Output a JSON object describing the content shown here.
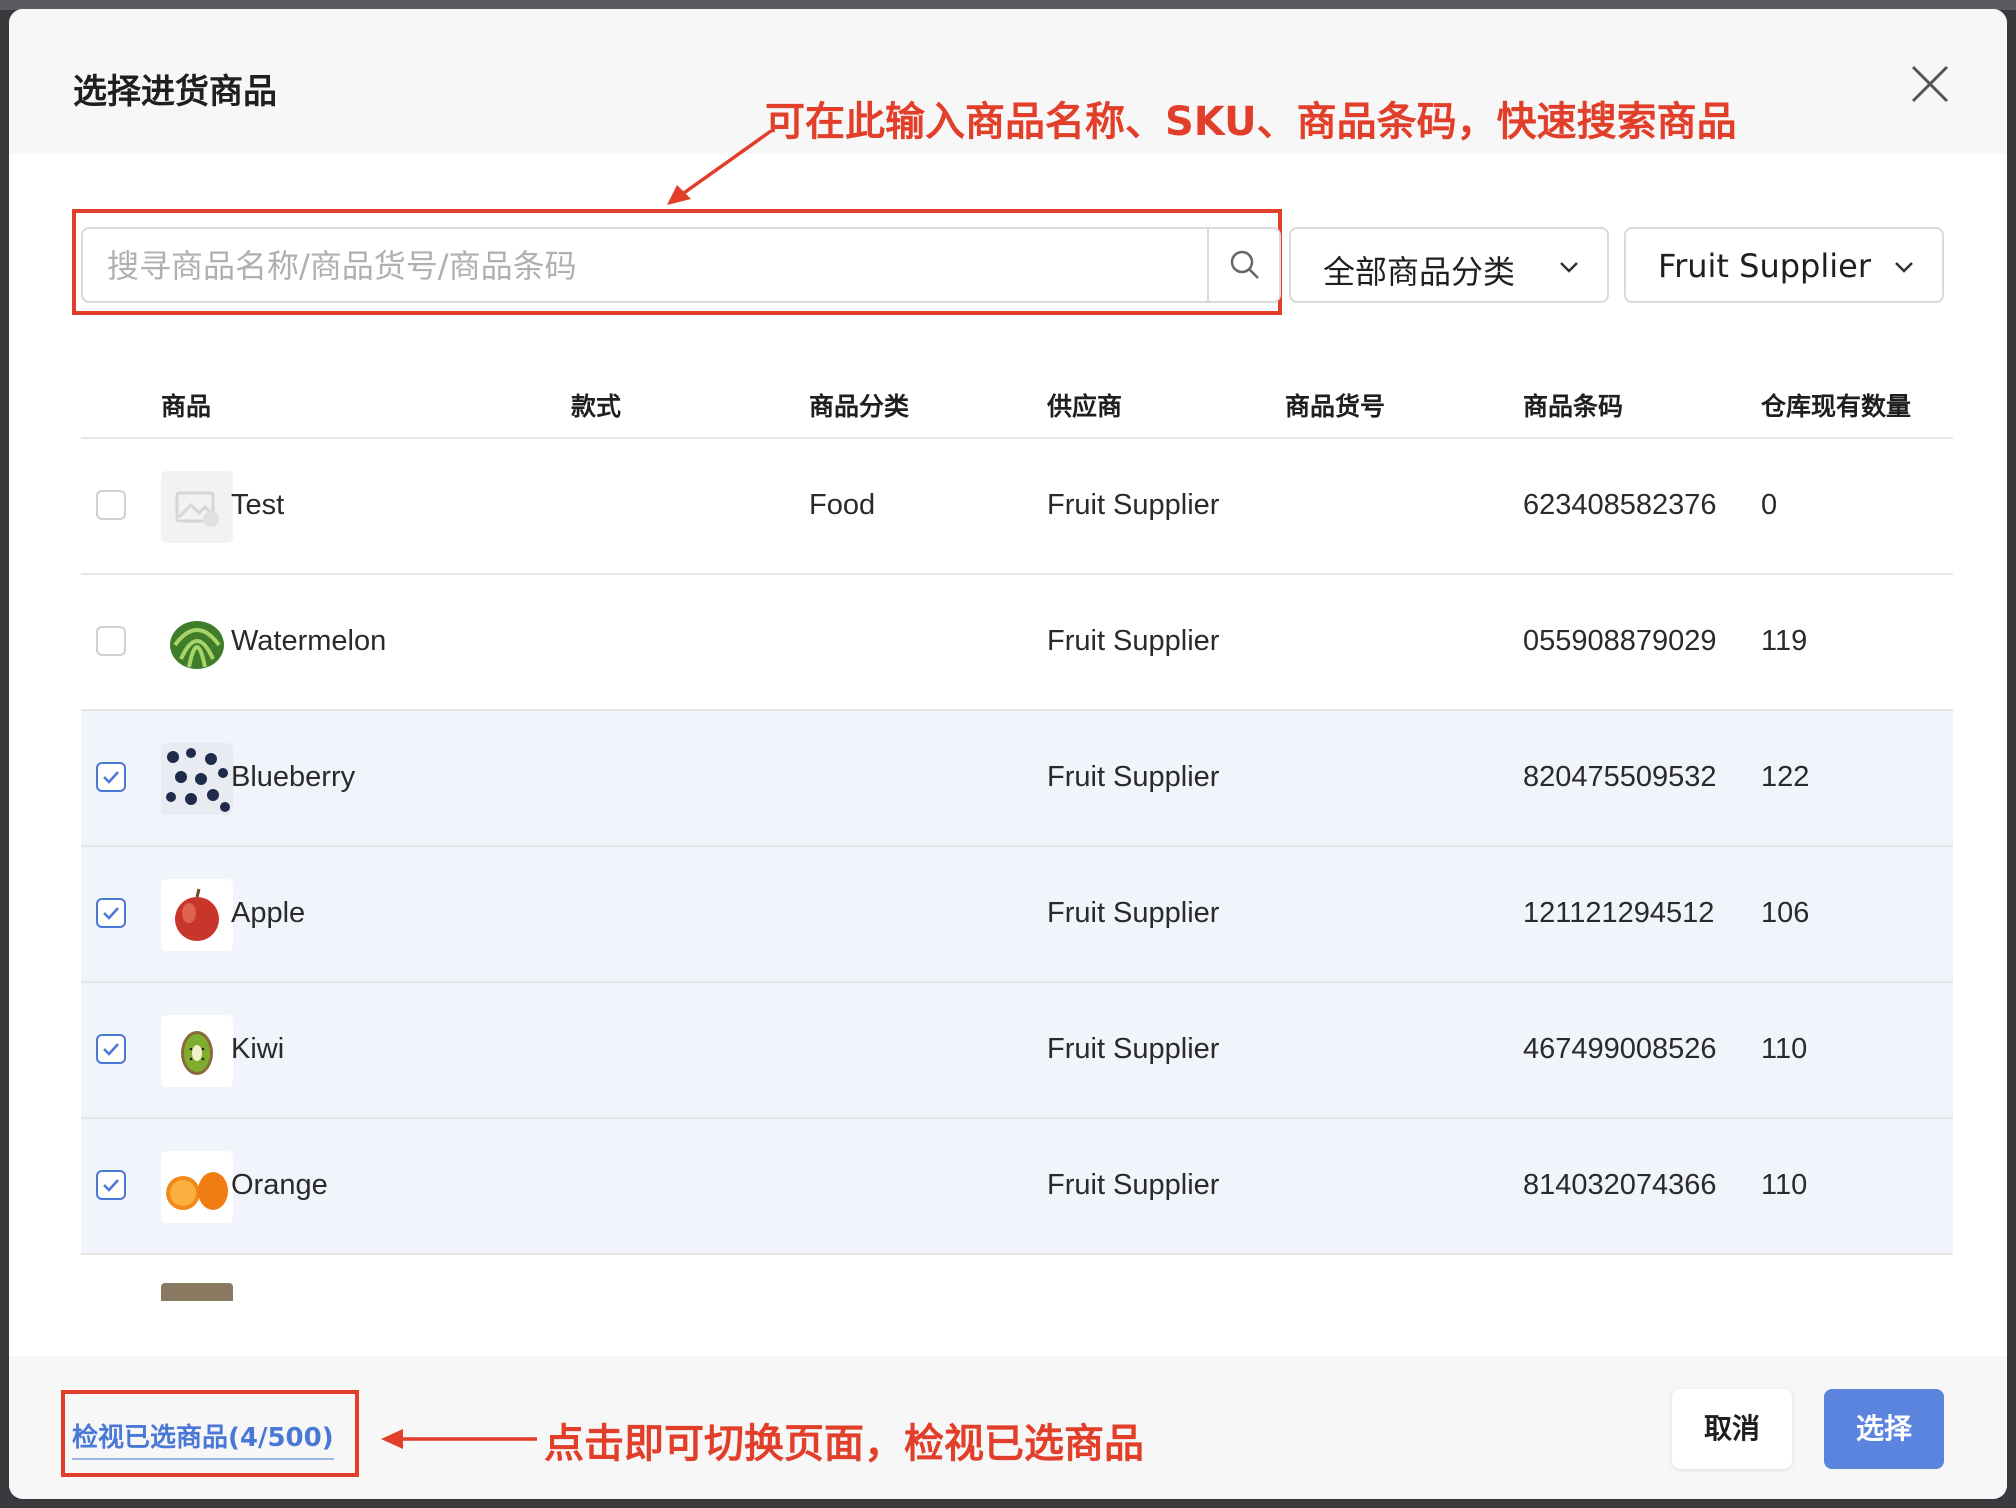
{
  "dialog": {
    "title": "选择进货商品",
    "close_icon": "close-icon"
  },
  "annotations": {
    "top_note": "可在此输入商品名称、SKU、商品条码，快速搜索商品",
    "bottom_note": "点击即可切换页面，检视已选商品",
    "color": "#e23f2a"
  },
  "search": {
    "placeholder": "搜寻商品名称/商品货号/商品条码",
    "value": "",
    "icon": "search-icon"
  },
  "filters": {
    "category": "全部商品分类",
    "supplier": "Fruit Supplier"
  },
  "table": {
    "columns": [
      "商品",
      "款式",
      "商品分类",
      "供应商",
      "商品货号",
      "商品条码",
      "仓库现有数量"
    ],
    "rows": [
      {
        "checked": false,
        "name": "Test",
        "style": "",
        "category": "Food",
        "supplier": "Fruit Supplier",
        "sku": "",
        "barcode": "623408582376",
        "qty": "0",
        "thumb": "placeholder-image"
      },
      {
        "checked": false,
        "name": "Watermelon",
        "style": "",
        "category": "",
        "supplier": "Fruit Supplier",
        "sku": "",
        "barcode": "055908879029",
        "qty": "119",
        "thumb": "watermelon"
      },
      {
        "checked": true,
        "name": "Blueberry",
        "style": "",
        "category": "",
        "supplier": "Fruit Supplier",
        "sku": "",
        "barcode": "820475509532",
        "qty": "122",
        "thumb": "blueberry"
      },
      {
        "checked": true,
        "name": "Apple",
        "style": "",
        "category": "",
        "supplier": "Fruit Supplier",
        "sku": "",
        "barcode": "121121294512",
        "qty": "106",
        "thumb": "apple"
      },
      {
        "checked": true,
        "name": "Kiwi",
        "style": "",
        "category": "",
        "supplier": "Fruit Supplier",
        "sku": "",
        "barcode": "467499008526",
        "qty": "110",
        "thumb": "kiwi"
      },
      {
        "checked": true,
        "name": "Orange",
        "style": "",
        "category": "",
        "supplier": "Fruit Supplier",
        "sku": "",
        "barcode": "814032074366",
        "qty": "110",
        "thumb": "orange"
      }
    ]
  },
  "footer": {
    "view_selected": "检视已选商品(4/500)",
    "cancel": "取消",
    "select": "选择"
  },
  "colors": {
    "accent": "#5b84de",
    "link": "#4a78d6",
    "selected_row": "#f1f5fb"
  }
}
